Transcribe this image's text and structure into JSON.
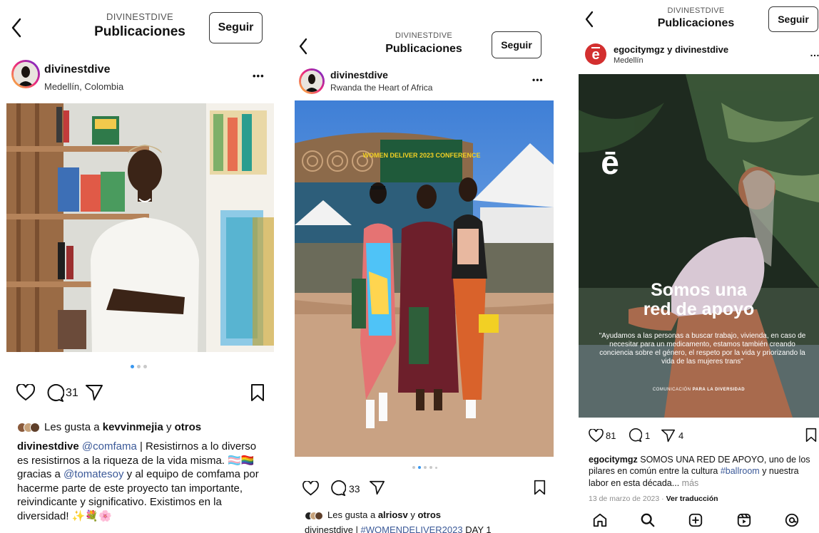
{
  "colors": {
    "accent_blue": "#3897f0",
    "link_blue": "#3b5998",
    "text": "#111111",
    "muted": "#8e8e8e"
  },
  "panel1": {
    "header": {
      "account": "DIVINESTDIVE",
      "title": "Publicaciones",
      "follow_label": "Seguir"
    },
    "post": {
      "username": "divinestdive",
      "location": "Medellín, Colombia",
      "more_icon": "•••",
      "carousel": {
        "count": 3,
        "active": 0
      },
      "comments_count": "31",
      "likes": {
        "prefix": "Les gusta a ",
        "user": "kevvinmejia",
        "connector": " y ",
        "others": "otros"
      },
      "caption": {
        "username": "divinestdive",
        "mention1": "@comfama",
        "text1": " | Resistirnos a lo diverso es resistirnos a la riqueza de la vida misma. 🏳️‍⚧️🏳️‍🌈 gracias a ",
        "mention2": "@tomatesoy",
        "text2": " y al equipo de comfama por hacerme parte de este proyecto tan importante, reivindicante y significativo. Existimos en la diversidad! ✨💐🌸"
      }
    }
  },
  "panel2": {
    "header": {
      "account": "DIVINESTDIVE",
      "title": "Publicaciones",
      "follow_label": "Seguir"
    },
    "post": {
      "username": "divinestdive",
      "location": "Rwanda the Heart of Africa",
      "more_icon": "•••",
      "carousel": {
        "count": 5,
        "active": 1
      },
      "comments_count": "33",
      "banner_text": "WOMEN DELIVER 2023 CONFERENCE",
      "likes": {
        "prefix": "Les gusta a ",
        "user": "alriosv",
        "connector": " y ",
        "others": "otros"
      },
      "caption": {
        "username": "divinestdive",
        "sep": " | ",
        "hashtag": "#WOMENDELIVER2023",
        "text": " DAY 1"
      }
    }
  },
  "panel3": {
    "header": {
      "account": "DIVINESTDIVE",
      "title": "Publicaciones",
      "follow_label": "Seguir"
    },
    "post": {
      "username": "egocitymgz y divinestdive",
      "location": "Medellín",
      "more_icon": "…",
      "poster": {
        "logo": "ē",
        "headline1": "Somos una",
        "headline2": "red de apoyo",
        "quote": "\"Ayudamos a las personas a buscar trabajo, vivienda, en caso de necesitar para un medicamento, estamos también creando conciencia sobre el género, el respeto por la vida y priorizando la vida de las mujeres trans\"",
        "footer_a": "COMUNICACIÓN ",
        "footer_b": "PARA LA DIVERSIDAD"
      },
      "likes_count": "81",
      "comments_count": "1",
      "shares_count": "4",
      "caption": {
        "username": "egocitymgz",
        "text1": " SOMOS UNA RED DE APOYO, uno de los pilares en común entre la cultura ",
        "hashtag": "#ballroom",
        "text2": " y nuestra labor en esta década...",
        "more": " más"
      },
      "date": "13 de marzo de 2023",
      "sep": " · ",
      "translate": "Ver traducción"
    },
    "nav": [
      "home-icon",
      "search-icon",
      "create-icon",
      "reels-icon",
      "threads-icon"
    ]
  }
}
